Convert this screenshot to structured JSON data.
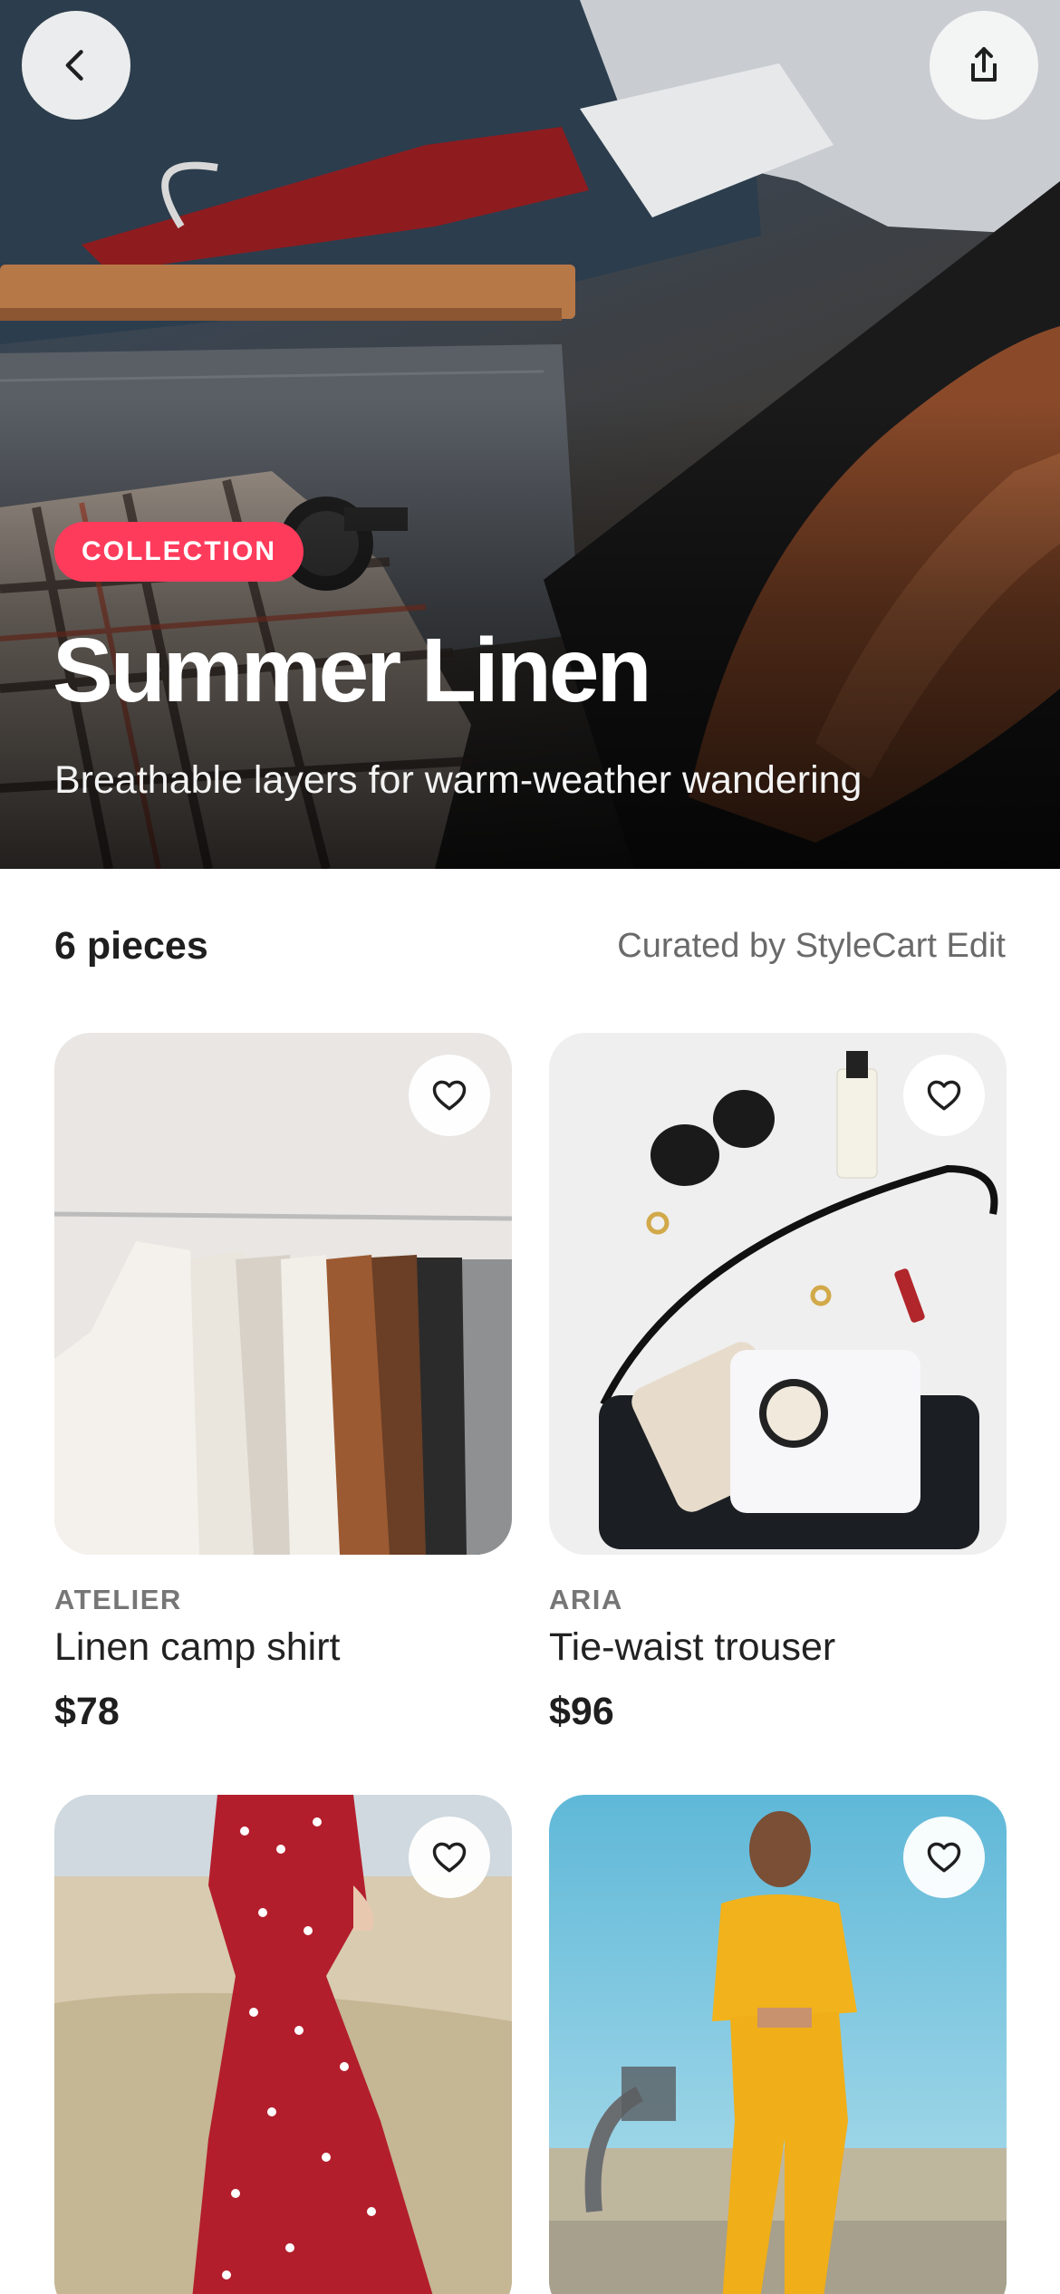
{
  "header": {
    "back_icon": "chevron-left-icon",
    "share_icon": "share-icon"
  },
  "hero": {
    "badge": "COLLECTION",
    "title": "Summer Linen",
    "subtitle": "Breathable layers for warm-weather wandering"
  },
  "meta": {
    "count": "6 pieces",
    "curated_by": "Curated by StyleCart Edit"
  },
  "products": [
    {
      "brand": "ATELIER",
      "name": "Linen camp shirt",
      "price": "$78",
      "favorite_icon": "heart-icon"
    },
    {
      "brand": "ARIA",
      "name": "Tie-waist trouser",
      "price": "$96",
      "favorite_icon": "heart-icon"
    },
    {
      "favorite_icon": "heart-icon"
    },
    {
      "favorite_icon": "heart-icon"
    }
  ],
  "colors": {
    "accent": "#ff3b5c",
    "text_primary": "#1f1f1f",
    "text_secondary": "#767676"
  }
}
